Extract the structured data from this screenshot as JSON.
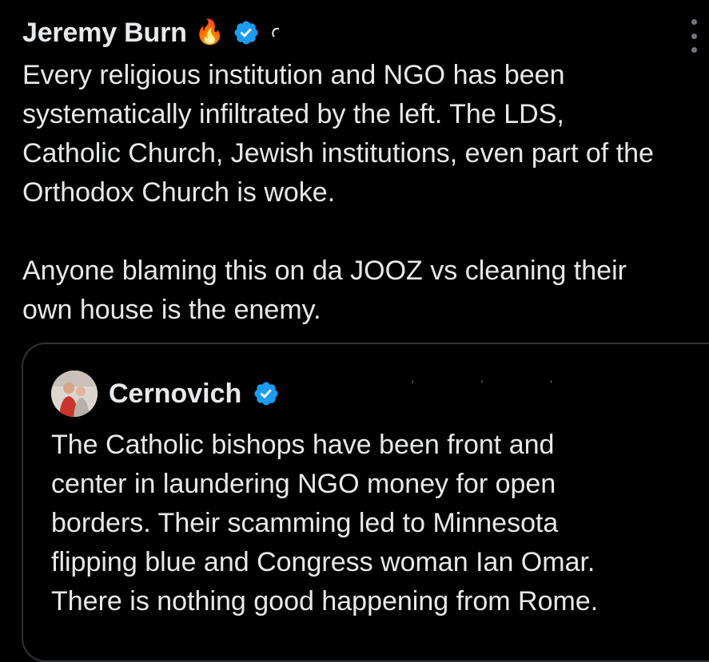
{
  "post": {
    "author": {
      "name": "Jeremy Burn",
      "emoji": "🔥",
      "verified_icon": "verified-badge-icon"
    },
    "menu_icon": "more-options-icon",
    "text_lines": [
      "Every religious institution and NGO has been",
      "systematically infiltrated by the left.  The LDS,",
      "Catholic Church, Jewish institutions, even part of the",
      "Orthodox Church is woke.",
      "",
      "Anyone blaming this on da JOOZ vs cleaning their",
      "own house is the enemy."
    ]
  },
  "quote": {
    "author": {
      "name": "Cernovich",
      "avatar_icon": "avatar-image",
      "verified_icon": "verified-badge-icon"
    },
    "text_lines": [
      "The Catholic bishops have been front and",
      "center in laundering NGO money for open",
      "borders. Their scamming led to Minnesota",
      "flipping blue and Congress woman Ian Omar.",
      "There is nothing good happening from Rome."
    ]
  },
  "colors": {
    "background": "#000000",
    "text": "#e7e9ea",
    "verified": "#1d9bf0",
    "border": "#2f3336",
    "muted": "#71767b"
  }
}
